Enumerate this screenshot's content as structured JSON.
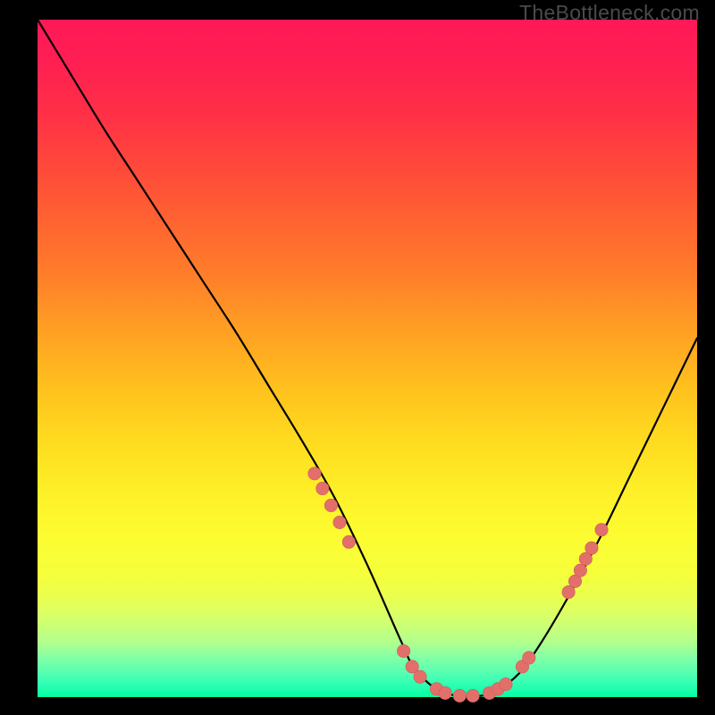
{
  "watermark": "TheBottleneck.com",
  "colors": {
    "background": "#000000",
    "curve_stroke": "#000000",
    "marker_fill": "#e36f6b",
    "marker_stroke": "#cf5a56"
  },
  "chart_data": {
    "type": "line",
    "title": "",
    "xlabel": "",
    "ylabel": "",
    "xlim": [
      0,
      100
    ],
    "ylim": [
      0,
      100
    ],
    "series": [
      {
        "name": "bottleneck-curve",
        "x": [
          0,
          5,
          10,
          15,
          20,
          25,
          30,
          35,
          40,
          45,
          50,
          55,
          57,
          60,
          63,
          65,
          68,
          70,
          73,
          76,
          80,
          85,
          90,
          95,
          100
        ],
        "y": [
          100,
          92,
          84,
          76.5,
          69,
          61.5,
          54,
          46,
          38,
          29.5,
          19.5,
          8.5,
          4.5,
          1.5,
          0.3,
          0.1,
          0.3,
          1.2,
          3.5,
          7.5,
          14,
          23,
          33,
          43,
          53
        ]
      }
    ],
    "markers": {
      "name": "highlighted-segments",
      "points": [
        {
          "x": 42.0,
          "y": 33.0
        },
        {
          "x": 43.2,
          "y": 30.8
        },
        {
          "x": 44.5,
          "y": 28.3
        },
        {
          "x": 45.8,
          "y": 25.8
        },
        {
          "x": 47.2,
          "y": 22.9
        },
        {
          "x": 55.5,
          "y": 6.8
        },
        {
          "x": 56.8,
          "y": 4.5
        },
        {
          "x": 58.0,
          "y": 3.0
        },
        {
          "x": 60.5,
          "y": 1.2
        },
        {
          "x": 61.8,
          "y": 0.6
        },
        {
          "x": 64.0,
          "y": 0.2
        },
        {
          "x": 66.0,
          "y": 0.2
        },
        {
          "x": 68.5,
          "y": 0.6
        },
        {
          "x": 69.8,
          "y": 1.2
        },
        {
          "x": 71.0,
          "y": 1.9
        },
        {
          "x": 73.5,
          "y": 4.5
        },
        {
          "x": 74.5,
          "y": 5.8
        },
        {
          "x": 80.5,
          "y": 15.5
        },
        {
          "x": 81.5,
          "y": 17.1
        },
        {
          "x": 82.3,
          "y": 18.7
        },
        {
          "x": 83.1,
          "y": 20.4
        },
        {
          "x": 84.0,
          "y": 22.0
        },
        {
          "x": 85.5,
          "y": 24.7
        }
      ]
    }
  }
}
